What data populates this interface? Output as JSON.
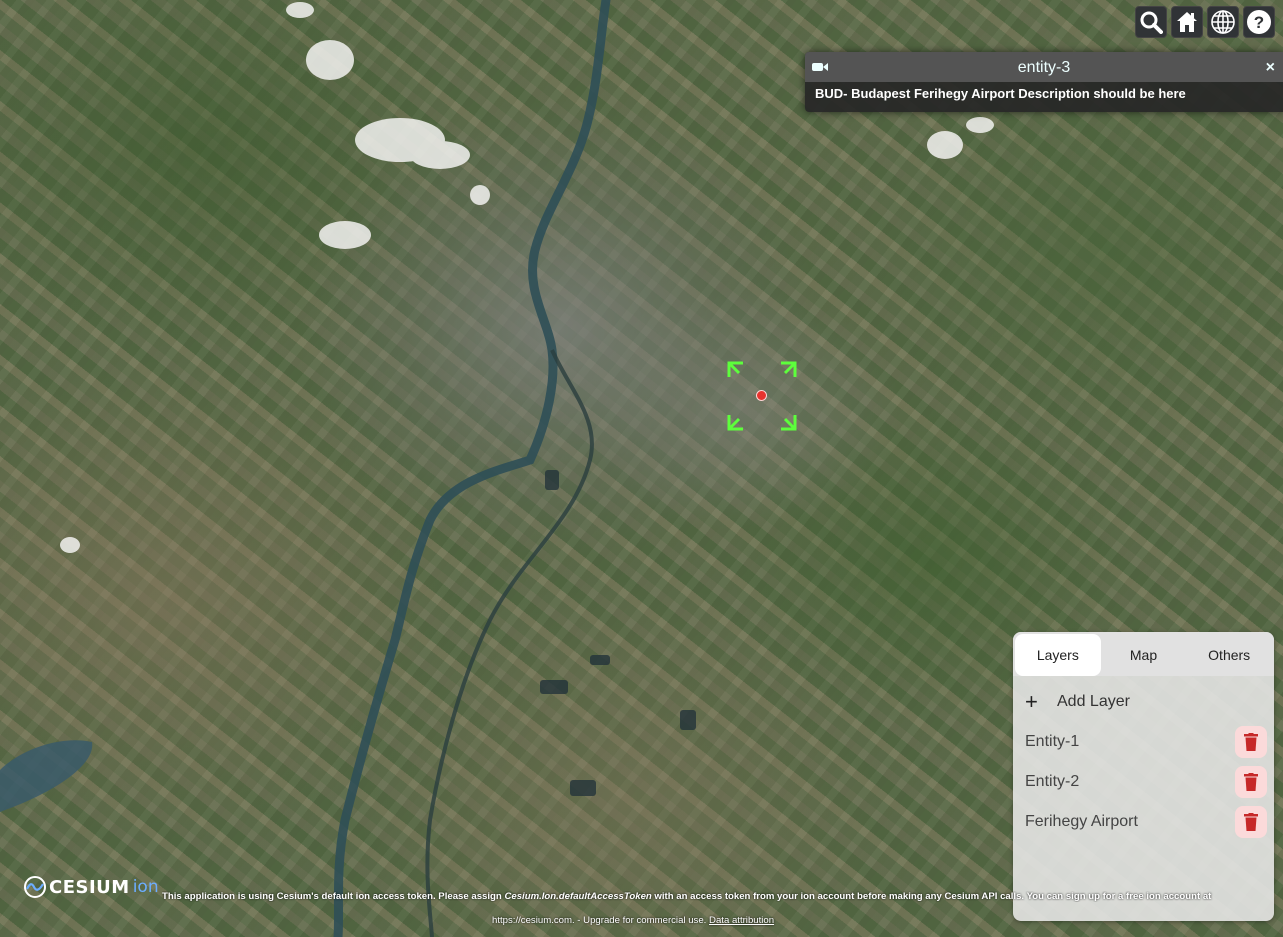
{
  "toolbar": {
    "buttons": [
      "search-icon",
      "home-icon",
      "globe-icon",
      "help-icon"
    ]
  },
  "infobox": {
    "title": "entity-3",
    "close_label": "×",
    "description": "BUD- Budapest Ferihegy Airport Description should be here"
  },
  "panel": {
    "tabs": [
      {
        "label": "Layers",
        "active": true
      },
      {
        "label": "Map",
        "active": false
      },
      {
        "label": "Others",
        "active": false
      }
    ],
    "add_icon": "+",
    "add_label": "Add Layer",
    "layers": [
      {
        "name": "Entity-1"
      },
      {
        "name": "Entity-2"
      },
      {
        "name": "Ferihegy Airport"
      }
    ]
  },
  "credits": {
    "logo_word": "CESIUM",
    "logo_ion": "ion",
    "line1_a": "This application is using Cesium's default ion access token. Please assign ",
    "line1_code": "Cesium.Ion.defaultAccessToken",
    "line1_b": " with an access token from your ion account before making any Cesium API calls. You can sign up for a free ion account at",
    "line2": "https://cesium.com. - Upgrade for commercial use.",
    "attribution_link": "Data attribution"
  },
  "colors": {
    "selector_green": "#5dff3c",
    "marker_red": "#e8332e",
    "delete_red": "#c62828"
  }
}
